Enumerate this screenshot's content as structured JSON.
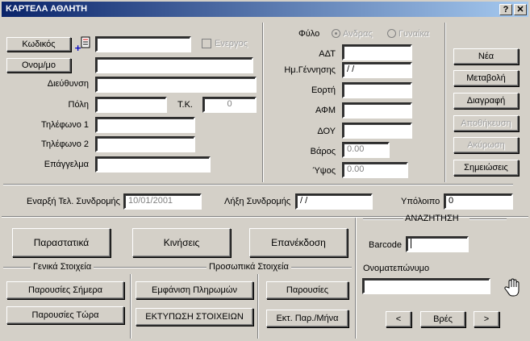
{
  "window": {
    "title": "ΚΑΡΤΕΛΑ ΑΘΛΗΤΗ",
    "help_label": "?",
    "close_label": "✕"
  },
  "personal": {
    "code_button": "Κωδικός",
    "name_button": "Ονομ/μο",
    "active_label": "Ενεργος",
    "address_label": "Διεύθυνση",
    "city_label": "Πόλη",
    "postcode_label": "Τ.Κ.",
    "postcode_value": "0",
    "phone1_label": "Τηλέφωνο 1",
    "phone2_label": "Τηλέφωνο 2",
    "profession_label": "Επάγγελμα"
  },
  "details": {
    "gender_label": "Φύλο",
    "male_label": "Ανδρας",
    "female_label": "Γυναίκα",
    "id_label": "ΑΔΤ",
    "birthdate_label": "Ημ.Γέννησης",
    "birthdate_value": " /  /",
    "nameday_label": "Εορτή",
    "afm_label": "ΑΦΜ",
    "doy_label": "ΔΟΥ",
    "weight_label": "Βάρος",
    "weight_value": "0.00",
    "height_label": "Ύψος",
    "height_value": "0.00"
  },
  "actions": {
    "new": "Νέα",
    "modify": "Μεταβολή",
    "delete": "Διαγραφή",
    "save": "Αποθήκευση",
    "cancel": "Ακύρωση",
    "notes": "Σημειώσεις"
  },
  "subscription": {
    "start_label": "Εναρξή Τελ. Συνδρομής",
    "start_value": "10/01/2001",
    "end_label": "Λήξη Συνδρομής",
    "end_value": " /  /",
    "balance_label": "Υπόλοιπο",
    "balance_value": "0"
  },
  "bottom": {
    "invoices": "Παραστατικά",
    "movements": "Κινήσεις",
    "renewal": "Επανέκδοση",
    "general_group": "Γενικά Στοιχεία",
    "personal_group": "Προσωπικά Στοιχεία",
    "attend_today": "Παρουσίες Σήμερα",
    "attend_now": "Παρουσίες Τώρα",
    "show_payments": "Εμφάνιση Πληρωμών",
    "print_details": "ΕΚΤΥΠΩΣΗ ΣΤΟΙΧΕΙΩΝ",
    "attendances": "Παρουσίες",
    "print_month": "Εκτ. Παρ./Μήνα"
  },
  "search": {
    "title": "ΑΝΑΖΗΤΗΣΗ",
    "barcode_label": "Barcode",
    "fullname_label": "Ονοματεπώνυμο",
    "prev_label": "<",
    "find_label": "Βρές",
    "next_label": ">"
  }
}
